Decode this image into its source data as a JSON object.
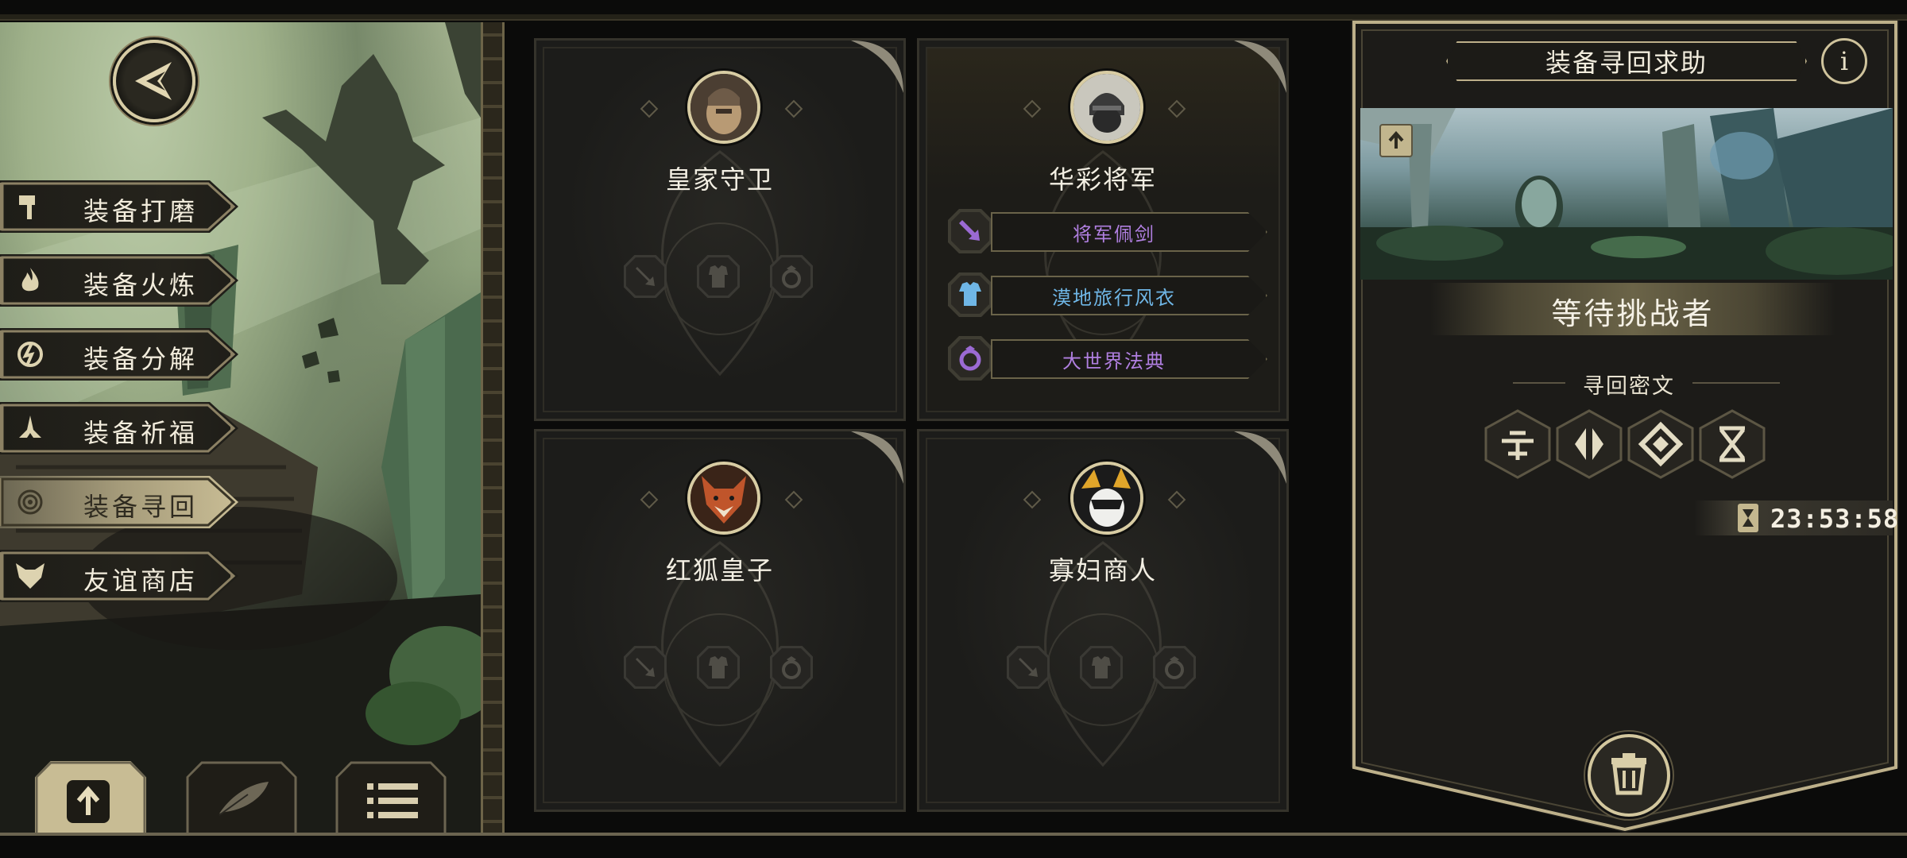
{
  "nav": {
    "back_icon": "arrow-back-icon",
    "menu": [
      {
        "label": "装备打磨",
        "icon": "hammer-icon",
        "active": false
      },
      {
        "label": "装备火炼",
        "icon": "flame-icon",
        "active": false
      },
      {
        "label": "装备分解",
        "icon": "break-icon",
        "active": false
      },
      {
        "label": "装备祈福",
        "icon": "pray-icon",
        "active": false
      },
      {
        "label": "装备寻回",
        "icon": "spiral-icon",
        "active": true
      },
      {
        "label": "友谊商店",
        "icon": "fox-icon",
        "active": false
      }
    ],
    "bottom_tabs": [
      {
        "icon": "upload-icon",
        "active": true
      },
      {
        "icon": "feather-icon",
        "active": false
      },
      {
        "icon": "list-icon",
        "active": false
      }
    ]
  },
  "cards": [
    {
      "name": "皇家守卫",
      "portrait": "royal-guard-portrait",
      "equipment": []
    },
    {
      "name": "华彩将军",
      "portrait": "general-portrait",
      "equipment": [
        {
          "name": "将军佩剑",
          "icon": "sword-icon",
          "color": "#b07fe0"
        },
        {
          "name": "漠地旅行风衣",
          "icon": "armor-icon",
          "color": "#6fb6e6"
        },
        {
          "name": "大世界法典",
          "icon": "ring-icon",
          "color": "#b07fe0"
        }
      ]
    },
    {
      "name": "红狐皇子",
      "portrait": "red-fox-portrait",
      "equipment": []
    },
    {
      "name": "寡妇商人",
      "portrait": "widow-merchant-portrait",
      "equipment": []
    }
  ],
  "panel": {
    "title": "装备寻回求助",
    "info_label": "i",
    "status": "等待挑战者",
    "cipher_title": "寻回密文",
    "runes": [
      "rune-1-icon",
      "rune-2-icon",
      "rune-3-icon",
      "rune-4-icon"
    ],
    "timer": "23:53:58"
  },
  "colors": {
    "gold": "#d6cba4",
    "purple_item": "#b07fe0",
    "blue_item": "#6fb6e6"
  }
}
